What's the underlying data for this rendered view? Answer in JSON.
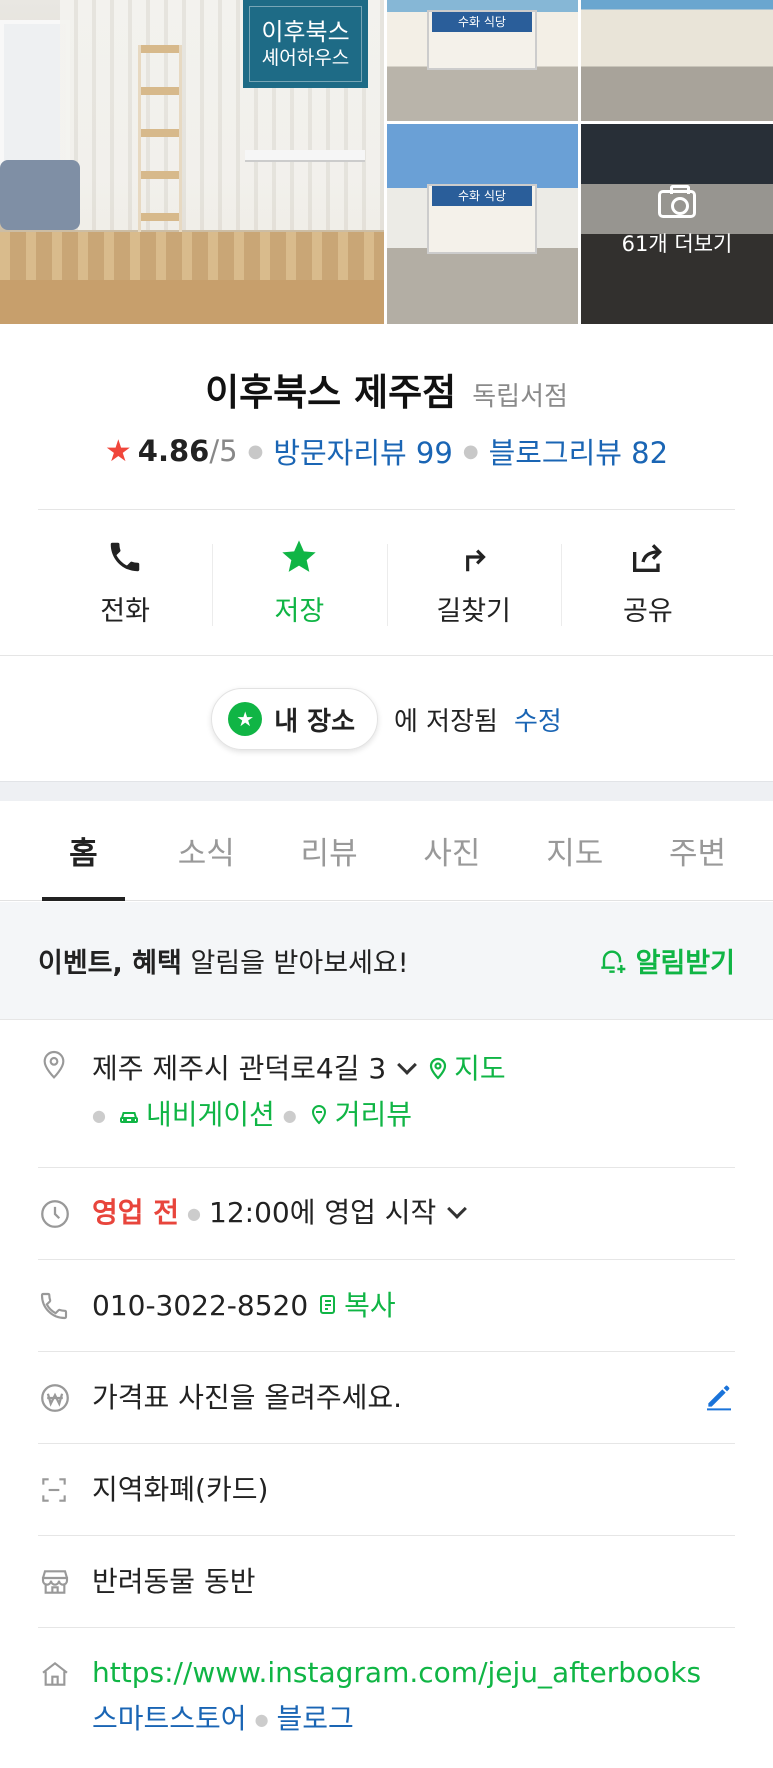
{
  "photos": {
    "main_sign_line1": "이후북스",
    "main_sign_line2": "셰어하우스",
    "shop_sign": "수화 식당",
    "more_label": "61개 더보기"
  },
  "place": {
    "name": "이후북스 제주점",
    "category": "독립서점",
    "rating": "4.86",
    "rating_max": "/5",
    "visitor_reviews": "방문자리뷰 99",
    "blog_reviews": "블로그리뷰 82"
  },
  "actions": [
    {
      "label": "전화",
      "icon": "phone-icon"
    },
    {
      "label": "저장",
      "icon": "star-icon"
    },
    {
      "label": "길찾기",
      "icon": "directions-icon"
    },
    {
      "label": "공유",
      "icon": "share-icon"
    }
  ],
  "saved": {
    "list_name": "내 장소",
    "saved_text": "에 저장됨",
    "edit_label": "수정"
  },
  "tabs": [
    "홈",
    "소식",
    "리뷰",
    "사진",
    "지도",
    "주변"
  ],
  "notice": {
    "bold_text": "이벤트, 혜택",
    "text": " 알림을 받아보세요!",
    "button_label": "알림받기"
  },
  "info": {
    "address": "제주 제주시 관덕로4길 3",
    "map_label": "지도",
    "navigation_label": "내비게이션",
    "street_view_label": "거리뷰",
    "status": "영업 전",
    "hours": "12:00에 영업 시작",
    "phone": "010-3022-8520",
    "copy_label": "복사",
    "price_placeholder": "가격표 사진을 올려주세요.",
    "payment": "지역화폐(카드)",
    "pet": "반려동물 동반",
    "website": "https://www.instagram.com/jeju_afterbooks",
    "smartstore_label": "스마트스토어",
    "blog_label": "블로그"
  },
  "colors": {
    "green": "#10b545",
    "blue": "#1a65b4",
    "red": "#e8453c"
  }
}
